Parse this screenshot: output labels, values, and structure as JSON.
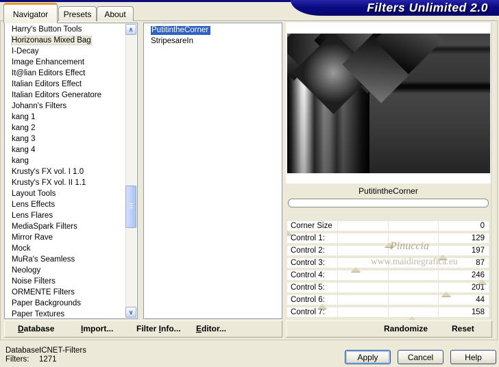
{
  "window": {
    "title": "Filters Unlimited 2.0"
  },
  "tabs": {
    "navigator": "Navigator",
    "presets": "Presets",
    "about": "About",
    "active": "Navigator"
  },
  "icons": {
    "scroll_up": "∧",
    "scroll_down": "∨"
  },
  "navigator": {
    "categories": [
      "Harry's Button Tools",
      "Horizonaus Mixed Bag",
      "I-Decay",
      "Image Enhancement",
      "It@lian Editors Effect",
      "Italian Editors Effect",
      "Italian Editors Generatore",
      "Johann's Filters",
      "kang 1",
      "kang 2",
      "kang 3",
      "kang 4",
      "kang",
      "Krusty's FX vol. I 1.0",
      "Krusty's FX vol. II 1.1",
      "Layout Tools",
      "Lens Effects",
      "Lens Flares",
      "MediaSpark Filters",
      "Mirror Rave",
      "Mock",
      "MuRa's Seamless",
      "Neology",
      "Noise Filters",
      "ORMENTE Filters",
      "Paper Backgrounds",
      "Paper Textures"
    ],
    "selected_category": "Horizonaus Mixed Bag",
    "filters": [
      "PutitintheCorner",
      "StripesareIn"
    ],
    "selected_filter": "PutitintheCorner"
  },
  "preview": {
    "filter_name": "PutitintheCorner",
    "progress_percent": 0
  },
  "parameters": {
    "range_max": 255,
    "items": [
      {
        "label": "Corner Size",
        "value": 0
      },
      {
        "label": "Control 1:",
        "value": 129
      },
      {
        "label": "Control 2:",
        "value": 197
      },
      {
        "label": "Control 3:",
        "value": 87
      },
      {
        "label": "Control 4:",
        "value": 246
      },
      {
        "label": "Control 5:",
        "value": 201
      },
      {
        "label": "Control 6:",
        "value": 44
      },
      {
        "label": "Control 7:",
        "value": 158
      }
    ]
  },
  "actions": {
    "database": {
      "pre": "",
      "key": "D",
      "post": "atabase"
    },
    "import": {
      "pre": "",
      "key": "I",
      "post": "mport..."
    },
    "filter_info": {
      "pre": "Filter ",
      "key": "I",
      "post": "nfo..."
    },
    "editor": {
      "pre": "",
      "key": "E",
      "post": "ditor..."
    },
    "randomize": "Randomize",
    "reset": "Reset"
  },
  "status": {
    "database_label": "Database:",
    "database_value": "ICNET-Filters",
    "filters_label": "Filters:",
    "filters_value": "1271"
  },
  "buttons": {
    "apply": "Apply",
    "cancel": "Cancel",
    "help": "Help"
  },
  "watermark": {
    "line1": "Pinuccia",
    "line2": "www.maidiregrafica.eu"
  },
  "colors": {
    "banner_blue": "#0b0b85",
    "tab_accent_orange": "#e89a31",
    "selection_blue": "#2f62c4",
    "dialog_background": "#ece9d8",
    "scrollbar_blue": "#b6c7ef"
  }
}
